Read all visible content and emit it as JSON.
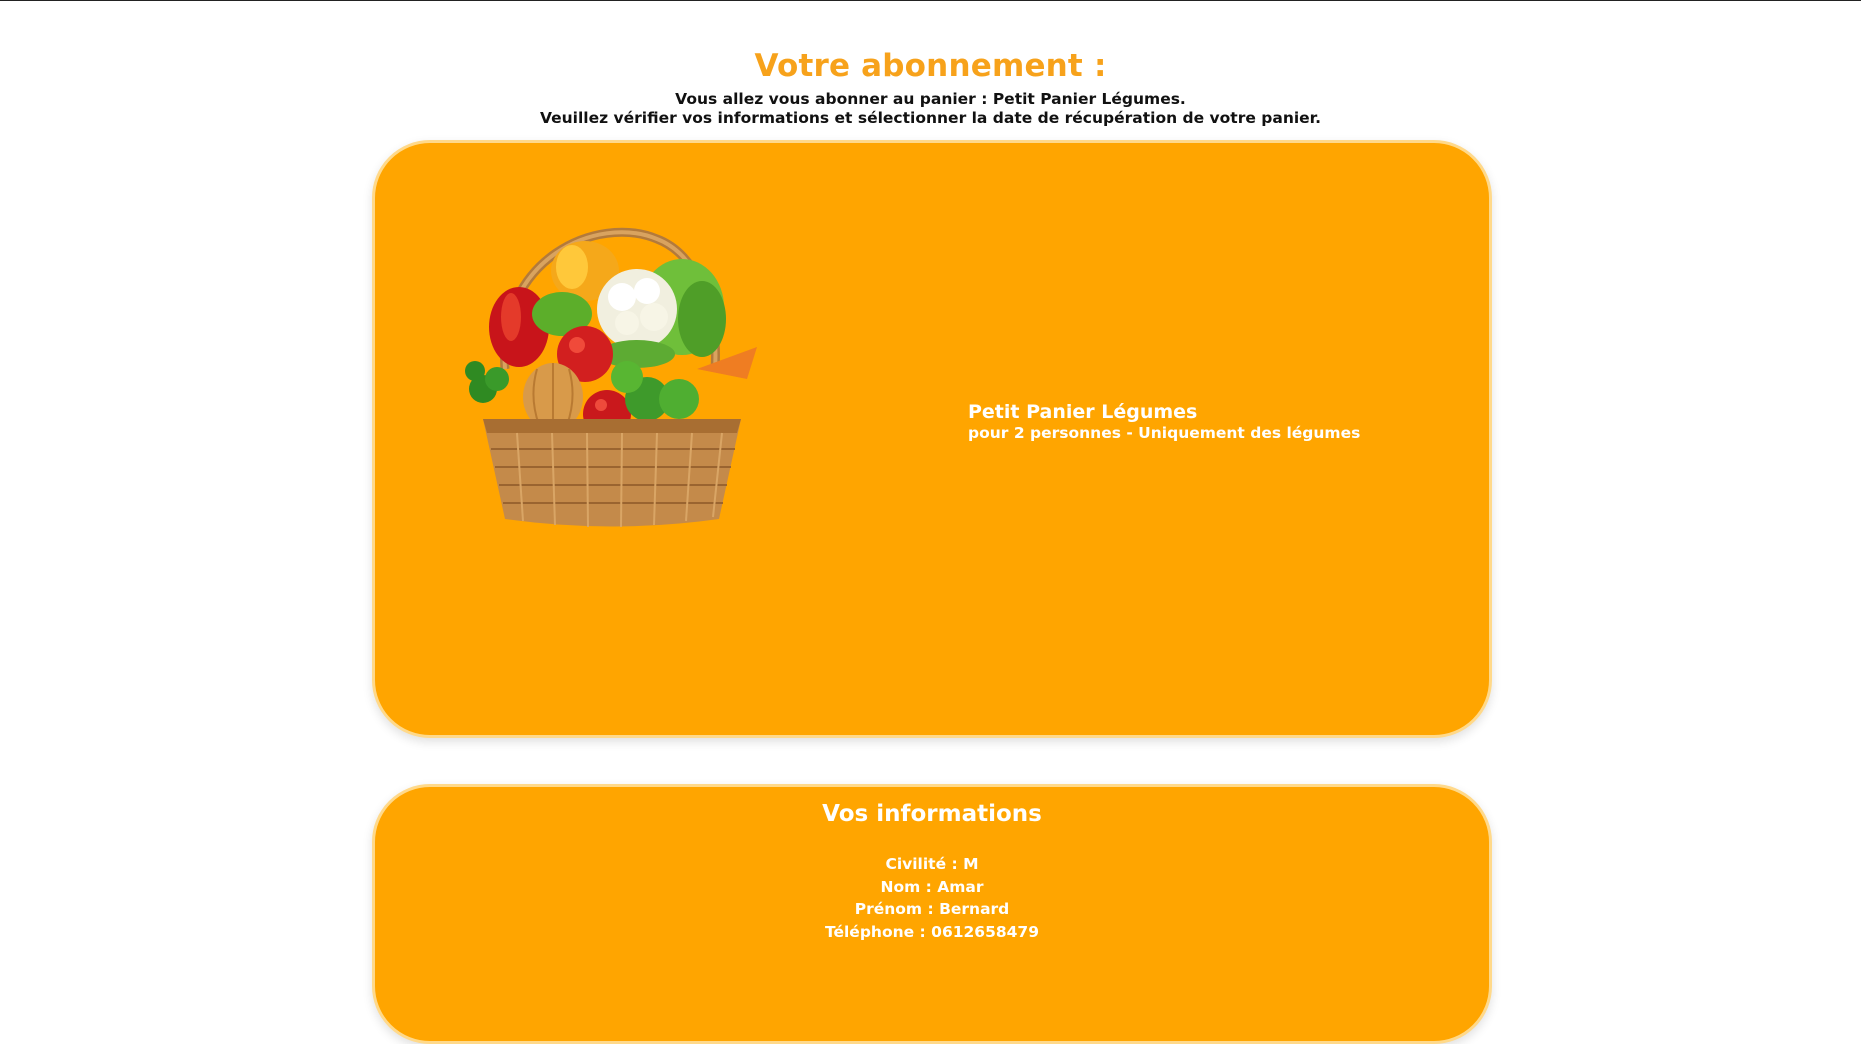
{
  "page": {
    "title": "Votre abonnement :",
    "intro_line1": "Vous allez vous abonner au panier : Petit Panier Légumes.",
    "intro_line2": "Veuillez vérifier vos informations et sélectionner la date de récupération de votre panier."
  },
  "product": {
    "name": "Petit Panier Légumes",
    "description": "pour 2 personnes - Uniquement des légumes",
    "image": "vegetable-basket"
  },
  "info": {
    "title": "Vos informations",
    "fields": [
      {
        "label": "Civilité",
        "value": "M"
      },
      {
        "label": "Nom",
        "value": "Amar"
      },
      {
        "label": "Prénom",
        "value": "Bernard"
      },
      {
        "label": "Téléphone",
        "value": "0612658479"
      }
    ]
  },
  "colors": {
    "accent": "#f7a21b",
    "card_background": "#ffa500",
    "card_text": "#ffffff"
  }
}
